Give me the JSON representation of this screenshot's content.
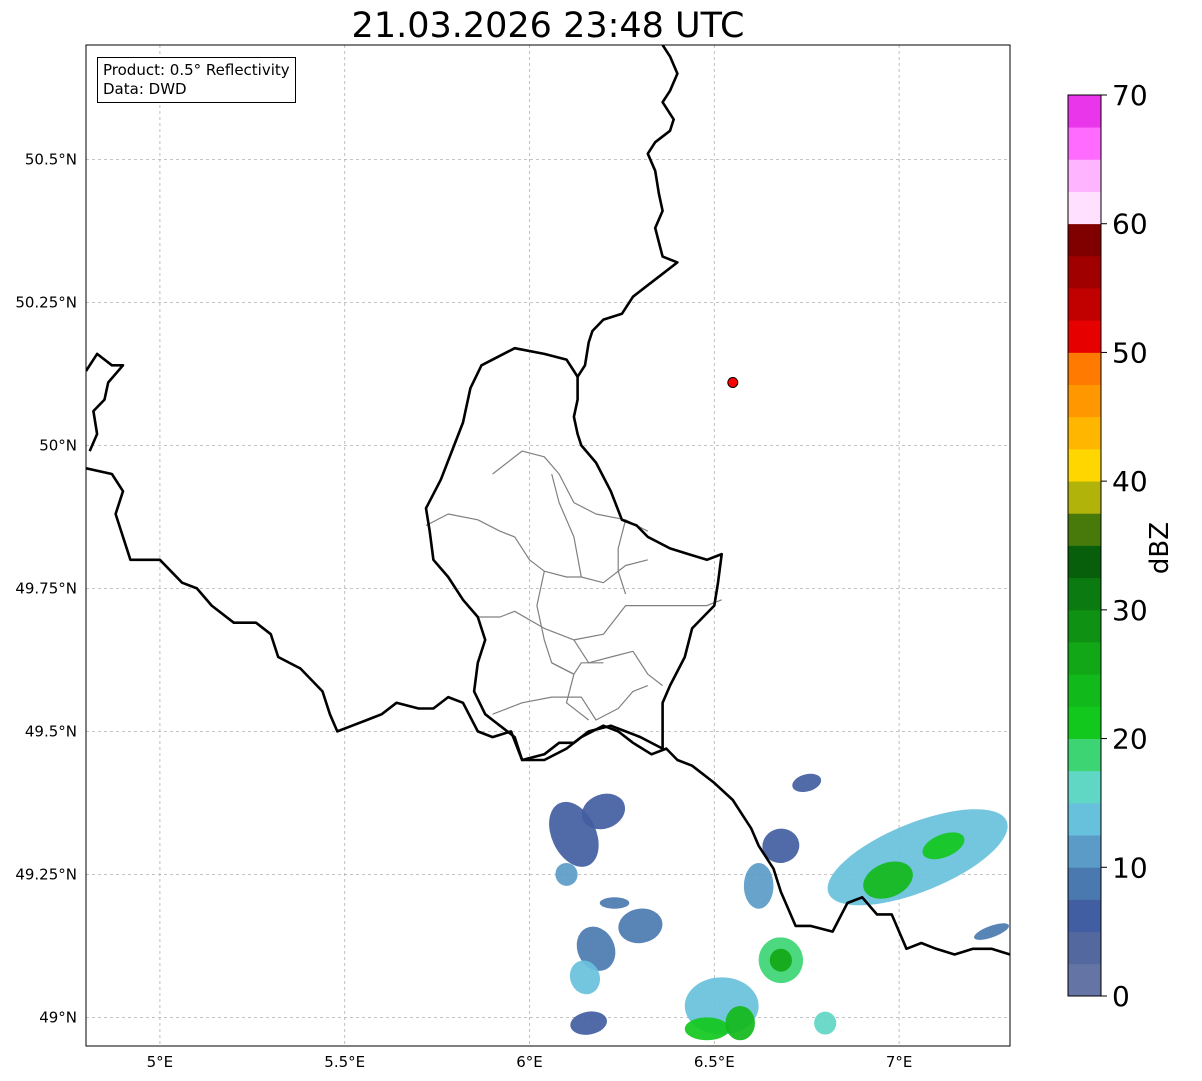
{
  "title": "21.03.2026 23:48 UTC",
  "info": {
    "line1": "Product: 0.5° Reflectivity",
    "line2": "Data: DWD"
  },
  "axes": {
    "lon_ticks": [
      {
        "value": 5.0,
        "label": "5°E"
      },
      {
        "value": 5.5,
        "label": "5.5°E"
      },
      {
        "value": 6.0,
        "label": "6°E"
      },
      {
        "value": 6.5,
        "label": "6.5°E"
      },
      {
        "value": 7.0,
        "label": "7°E"
      }
    ],
    "lat_ticks": [
      {
        "value": 49.0,
        "label": "49°N"
      },
      {
        "value": 49.25,
        "label": "49.25°N"
      },
      {
        "value": 49.5,
        "label": "49.5°N"
      },
      {
        "value": 49.75,
        "label": "49.75°N"
      },
      {
        "value": 50.0,
        "label": "50°N"
      },
      {
        "value": 50.25,
        "label": "50.25°N"
      },
      {
        "value": 50.5,
        "label": "50.5°N"
      }
    ],
    "lon_range": [
      4.8,
      7.3
    ],
    "lat_range": [
      48.95,
      50.7
    ],
    "grid": true
  },
  "colorbar": {
    "label": "dBZ",
    "range": [
      0,
      70
    ],
    "ticks": [
      0,
      10,
      20,
      30,
      40,
      50,
      60,
      70
    ],
    "colors": [
      "#6474a4",
      "#5468a0",
      "#425ea2",
      "#4a79b0",
      "#5b9bc7",
      "#68c1dc",
      "#60d6c4",
      "#3dd574",
      "#12c81d",
      "#12b91a",
      "#12a716",
      "#0f9114",
      "#0b7a11",
      "#075e0b",
      "#487a0b",
      "#b1b30b",
      "#ffd600",
      "#ffb600",
      "#ff9800",
      "#ff7a00",
      "#e70000",
      "#c10000",
      "#a00000",
      "#800000",
      "#ffe0ff",
      "#ffb4ff",
      "#ff6aff",
      "#ea36ea"
    ]
  },
  "marker": {
    "lon": 6.55,
    "lat": 50.11,
    "color": "#ff0000"
  },
  "borders": {
    "national": [
      [
        [
          4.8,
          50.13
        ],
        [
          4.83,
          50.16
        ],
        [
          4.87,
          50.14
        ],
        [
          4.9,
          50.14
        ],
        [
          4.86,
          50.11
        ],
        [
          4.85,
          50.08
        ],
        [
          4.82,
          50.06
        ],
        [
          4.83,
          50.02
        ],
        [
          4.81,
          49.99
        ]
      ],
      [
        [
          4.8,
          49.96
        ],
        [
          4.87,
          49.95
        ],
        [
          4.9,
          49.92
        ],
        [
          4.88,
          49.88
        ],
        [
          4.92,
          49.8
        ],
        [
          4.96,
          49.8
        ],
        [
          5.0,
          49.8
        ],
        [
          5.06,
          49.76
        ],
        [
          5.1,
          49.75
        ],
        [
          5.14,
          49.72
        ],
        [
          5.2,
          49.69
        ],
        [
          5.26,
          49.69
        ],
        [
          5.3,
          49.67
        ],
        [
          5.32,
          49.63
        ],
        [
          5.38,
          49.61
        ],
        [
          5.44,
          49.57
        ],
        [
          5.46,
          49.53
        ],
        [
          5.48,
          49.5
        ],
        [
          5.52,
          49.51
        ],
        [
          5.56,
          49.52
        ],
        [
          5.6,
          49.53
        ],
        [
          5.64,
          49.55
        ],
        [
          5.7,
          49.54
        ],
        [
          5.74,
          49.54
        ],
        [
          5.78,
          49.56
        ],
        [
          5.82,
          49.55
        ],
        [
          5.86,
          49.5
        ],
        [
          5.9,
          49.49
        ],
        [
          5.95,
          49.5
        ],
        [
          5.98,
          49.45
        ],
        [
          6.04,
          49.45
        ],
        [
          6.1,
          49.47
        ],
        [
          6.14,
          49.49
        ],
        [
          6.2,
          49.51
        ],
        [
          6.24,
          49.5
        ],
        [
          6.28,
          49.48
        ],
        [
          6.33,
          49.46
        ],
        [
          6.37,
          49.47
        ],
        [
          6.4,
          49.45
        ],
        [
          6.44,
          49.44
        ],
        [
          6.5,
          49.41
        ],
        [
          6.55,
          49.38
        ],
        [
          6.58,
          49.35
        ],
        [
          6.6,
          49.33
        ],
        [
          6.62,
          49.3
        ],
        [
          6.66,
          49.26
        ],
        [
          6.68,
          49.22
        ],
        [
          6.72,
          49.16
        ],
        [
          6.76,
          49.16
        ],
        [
          6.82,
          49.15
        ],
        [
          6.86,
          49.2
        ],
        [
          6.9,
          49.21
        ],
        [
          6.94,
          49.18
        ],
        [
          6.98,
          49.18
        ],
        [
          7.02,
          49.12
        ],
        [
          7.06,
          49.13
        ],
        [
          7.1,
          49.12
        ],
        [
          7.15,
          49.11
        ],
        [
          7.2,
          49.12
        ],
        [
          7.25,
          49.12
        ],
        [
          7.3,
          49.11
        ]
      ],
      [
        [
          6.36,
          50.7
        ],
        [
          6.38,
          50.68
        ],
        [
          6.4,
          50.65
        ],
        [
          6.38,
          50.62
        ],
        [
          6.36,
          50.6
        ],
        [
          6.39,
          50.57
        ],
        [
          6.38,
          50.55
        ],
        [
          6.34,
          50.53
        ],
        [
          6.32,
          50.51
        ],
        [
          6.34,
          50.48
        ],
        [
          6.35,
          50.44
        ],
        [
          6.36,
          50.41
        ],
        [
          6.34,
          50.38
        ],
        [
          6.36,
          50.33
        ],
        [
          6.4,
          50.32
        ],
        [
          6.36,
          50.3
        ],
        [
          6.32,
          50.28
        ],
        [
          6.28,
          50.26
        ],
        [
          6.25,
          50.23
        ],
        [
          6.2,
          50.22
        ],
        [
          6.17,
          50.2
        ],
        [
          6.16,
          50.18
        ],
        [
          6.15,
          50.14
        ],
        [
          6.13,
          50.12
        ],
        [
          6.13,
          50.08
        ],
        [
          6.12,
          50.05
        ],
        [
          6.13,
          50.02
        ],
        [
          6.14,
          50.0
        ],
        [
          6.18,
          49.97
        ],
        [
          6.22,
          49.92
        ],
        [
          6.25,
          49.87
        ],
        [
          6.29,
          49.86
        ],
        [
          6.32,
          49.84
        ],
        [
          6.38,
          49.82
        ],
        [
          6.43,
          49.81
        ],
        [
          6.48,
          49.8
        ],
        [
          6.52,
          49.81
        ],
        [
          6.51,
          49.76
        ],
        [
          6.5,
          49.72
        ],
        [
          6.44,
          49.68
        ],
        [
          6.42,
          49.63
        ],
        [
          6.38,
          49.58
        ],
        [
          6.36,
          49.55
        ],
        [
          6.36,
          49.47
        ]
      ],
      [
        [
          6.36,
          49.47
        ],
        [
          6.3,
          49.49
        ],
        [
          6.26,
          49.5
        ],
        [
          6.22,
          49.51
        ],
        [
          6.16,
          49.5
        ],
        [
          6.12,
          49.48
        ],
        [
          6.08,
          49.48
        ],
        [
          6.04,
          49.46
        ],
        [
          5.98,
          49.45
        ],
        [
          5.96,
          49.49
        ],
        [
          5.9,
          49.52
        ],
        [
          5.88,
          49.53
        ],
        [
          5.85,
          49.57
        ],
        [
          5.86,
          49.62
        ],
        [
          5.88,
          49.66
        ],
        [
          5.86,
          49.7
        ],
        [
          5.82,
          49.73
        ],
        [
          5.78,
          49.77
        ],
        [
          5.74,
          49.8
        ],
        [
          5.73,
          49.85
        ],
        [
          5.72,
          49.89
        ],
        [
          5.76,
          49.94
        ],
        [
          5.79,
          49.99
        ],
        [
          5.82,
          50.04
        ],
        [
          5.84,
          50.1
        ],
        [
          5.87,
          50.14
        ],
        [
          5.96,
          50.17
        ],
        [
          6.04,
          50.16
        ],
        [
          6.1,
          50.15
        ],
        [
          6.12,
          50.13
        ],
        [
          6.13,
          50.12
        ]
      ]
    ],
    "regional": [
      [
        [
          5.9,
          49.95
        ],
        [
          5.98,
          49.99
        ],
        [
          6.04,
          49.98
        ],
        [
          6.08,
          49.95
        ],
        [
          6.12,
          49.9
        ],
        [
          6.18,
          49.88
        ],
        [
          6.26,
          49.87
        ],
        [
          6.32,
          49.85
        ]
      ],
      [
        [
          5.72,
          49.86
        ],
        [
          5.78,
          49.88
        ],
        [
          5.86,
          49.87
        ],
        [
          5.92,
          49.85
        ],
        [
          5.96,
          49.84
        ],
        [
          6.0,
          49.8
        ],
        [
          6.04,
          49.78
        ],
        [
          6.1,
          49.77
        ],
        [
          6.14,
          49.77
        ],
        [
          6.2,
          49.76
        ],
        [
          6.26,
          49.79
        ],
        [
          6.32,
          49.8
        ]
      ],
      [
        [
          6.04,
          49.78
        ],
        [
          6.02,
          49.72
        ],
        [
          6.04,
          49.66
        ],
        [
          6.06,
          49.62
        ],
        [
          6.12,
          49.6
        ],
        [
          6.1,
          49.55
        ],
        [
          6.16,
          49.52
        ]
      ],
      [
        [
          5.86,
          49.7
        ],
        [
          5.92,
          49.7
        ],
        [
          5.96,
          49.71
        ],
        [
          6.04,
          49.68
        ],
        [
          6.12,
          49.66
        ],
        [
          6.2,
          49.67
        ],
        [
          6.26,
          49.72
        ],
        [
          6.32,
          49.72
        ],
        [
          6.38,
          49.72
        ],
        [
          6.42,
          49.72
        ],
        [
          6.48,
          49.72
        ],
        [
          6.52,
          49.73
        ]
      ],
      [
        [
          6.12,
          49.66
        ],
        [
          6.16,
          49.62
        ],
        [
          6.22,
          49.63
        ],
        [
          6.28,
          49.64
        ],
        [
          6.32,
          49.6
        ],
        [
          6.36,
          49.58
        ]
      ],
      [
        [
          5.9,
          49.53
        ],
        [
          5.98,
          49.55
        ],
        [
          6.06,
          49.56
        ],
        [
          6.14,
          49.56
        ],
        [
          6.18,
          49.52
        ],
        [
          6.24,
          49.54
        ],
        [
          6.28,
          49.57
        ],
        [
          6.32,
          49.58
        ]
      ],
      [
        [
          6.06,
          49.62
        ],
        [
          6.12,
          49.6
        ],
        [
          6.14,
          49.62
        ],
        [
          6.2,
          49.62
        ]
      ],
      [
        [
          6.26,
          49.87
        ],
        [
          6.24,
          49.82
        ],
        [
          6.24,
          49.78
        ],
        [
          6.26,
          49.74
        ]
      ],
      [
        [
          6.14,
          49.77
        ],
        [
          6.12,
          49.84
        ],
        [
          6.08,
          49.9
        ],
        [
          6.06,
          49.95
        ]
      ]
    ]
  },
  "echoes": [
    {
      "lon": 6.12,
      "lat": 49.32,
      "rx": 0.06,
      "ry": 0.06,
      "rot": -25,
      "dbz": 6
    },
    {
      "lon": 6.2,
      "lat": 49.36,
      "rx": 0.06,
      "ry": 0.03,
      "rot": -20,
      "dbz": 6
    },
    {
      "lon": 6.1,
      "lat": 49.25,
      "rx": 0.03,
      "ry": 0.02,
      "rot": -15,
      "dbz": 11
    },
    {
      "lon": 6.23,
      "lat": 49.2,
      "rx": 0.04,
      "ry": 0.01,
      "rot": 0,
      "dbz": 8
    },
    {
      "lon": 6.18,
      "lat": 49.12,
      "rx": 0.05,
      "ry": 0.04,
      "rot": -25,
      "dbz": 9
    },
    {
      "lon": 6.15,
      "lat": 49.07,
      "rx": 0.04,
      "ry": 0.03,
      "rot": -20,
      "dbz": 14
    },
    {
      "lon": 6.16,
      "lat": 48.99,
      "rx": 0.05,
      "ry": 0.02,
      "rot": -10,
      "dbz": 7
    },
    {
      "lon": 6.3,
      "lat": 49.16,
      "rx": 0.06,
      "ry": 0.03,
      "rot": -10,
      "dbz": 8
    },
    {
      "lon": 6.52,
      "lat": 49.02,
      "rx": 0.1,
      "ry": 0.05,
      "rot": 0,
      "dbz": 14
    },
    {
      "lon": 6.48,
      "lat": 48.98,
      "rx": 0.06,
      "ry": 0.02,
      "rot": 0,
      "dbz": 22
    },
    {
      "lon": 6.57,
      "lat": 48.99,
      "rx": 0.04,
      "ry": 0.03,
      "rot": 0,
      "dbz": 24
    },
    {
      "lon": 6.68,
      "lat": 49.1,
      "rx": 0.06,
      "ry": 0.04,
      "rot": -10,
      "dbz": 18
    },
    {
      "lon": 6.68,
      "lat": 49.1,
      "rx": 0.03,
      "ry": 0.02,
      "rot": -10,
      "dbz": 26
    },
    {
      "lon": 6.62,
      "lat": 49.23,
      "rx": 0.04,
      "ry": 0.04,
      "rot": 0,
      "dbz": 11
    },
    {
      "lon": 6.68,
      "lat": 49.3,
      "rx": 0.05,
      "ry": 0.03,
      "rot": -10,
      "dbz": 7
    },
    {
      "lon": 6.75,
      "lat": 49.41,
      "rx": 0.04,
      "ry": 0.015,
      "rot": -15,
      "dbz": 7
    },
    {
      "lon": 6.8,
      "lat": 48.99,
      "rx": 0.03,
      "ry": 0.02,
      "rot": 0,
      "dbz": 17
    },
    {
      "lon": 7.05,
      "lat": 49.28,
      "rx": 0.26,
      "ry": 0.06,
      "rot": -22,
      "dbz": 13
    },
    {
      "lon": 6.97,
      "lat": 49.24,
      "rx": 0.07,
      "ry": 0.03,
      "rot": -22,
      "dbz": 24
    },
    {
      "lon": 7.12,
      "lat": 49.3,
      "rx": 0.06,
      "ry": 0.02,
      "rot": -22,
      "dbz": 21
    },
    {
      "lon": 7.25,
      "lat": 49.15,
      "rx": 0.05,
      "ry": 0.01,
      "rot": -20,
      "dbz": 8
    }
  ]
}
